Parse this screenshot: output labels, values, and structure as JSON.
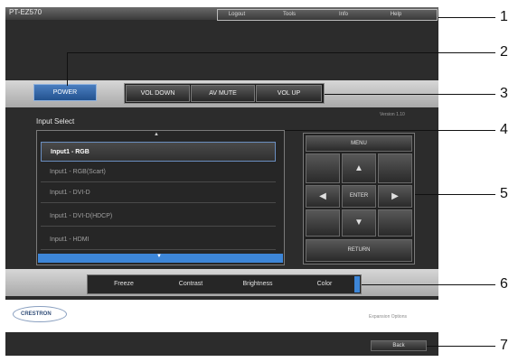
{
  "window": {
    "title": "PT-EZ570"
  },
  "top_links": [
    "Logout",
    "Tools",
    "Info",
    "Help"
  ],
  "controls": {
    "power": "POWER",
    "vol_down": "VOL DOWN",
    "av_mute": "AV MUTE",
    "vol_up": "VOL UP"
  },
  "version": "Version 1.10",
  "input_select": {
    "heading": "Input Select",
    "items": [
      "Input1 - RGB",
      "Input1 - RGB(Scart)",
      "Input1 - DVI-D",
      "Input1 - DVI-D(HDCP)",
      "Input1 - HDMI"
    ],
    "selected_index": 0
  },
  "nav": {
    "menu": "MENU",
    "enter": "ENTER",
    "return": "RETURN"
  },
  "picture": [
    "Freeze",
    "Contrast",
    "Brightness",
    "Color"
  ],
  "footer": {
    "brand": "CRESTRON",
    "expansion": "Expansion Options",
    "back": "Back"
  },
  "callouts": [
    "1",
    "2",
    "3",
    "4",
    "5",
    "6",
    "7"
  ]
}
